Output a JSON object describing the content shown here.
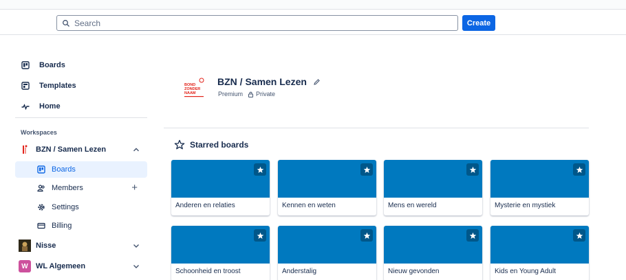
{
  "search": {
    "placeholder": "Search"
  },
  "header": {
    "create_label": "Create"
  },
  "sidebar": {
    "nav": [
      {
        "label": "Boards",
        "icon": "board-icon"
      },
      {
        "label": "Templates",
        "icon": "template-icon"
      },
      {
        "label": "Home",
        "icon": "home-pulse-icon"
      }
    ],
    "workspaces_heading": "Workspaces",
    "workspaces": [
      {
        "label": "BZN / Samen Lezen",
        "expanded": true,
        "items": [
          {
            "label": "Boards",
            "icon": "board-icon",
            "active": true
          },
          {
            "label": "Members",
            "icon": "members-icon"
          },
          {
            "label": "Settings",
            "icon": "gear-icon"
          },
          {
            "label": "Billing",
            "icon": "credit-card-icon"
          }
        ]
      },
      {
        "label": "Nisse",
        "expanded": false
      },
      {
        "label": "WL Algemeen",
        "expanded": false,
        "logo_letter": "W"
      }
    ]
  },
  "workspace": {
    "title": "BZN / Samen Lezen",
    "plan": "Premium",
    "visibility": "Private",
    "logo_text": [
      "BOND",
      "ZONDER",
      "NAAM"
    ]
  },
  "starred": {
    "heading": "Starred boards",
    "boards": [
      {
        "name": "Anderen en relaties",
        "color": "#0079bf"
      },
      {
        "name": "Kennen en weten",
        "color": "#0079bf"
      },
      {
        "name": "Mens en wereld",
        "color": "#0079bf"
      },
      {
        "name": "Mysterie en mystiek",
        "color": "#0079bf"
      },
      {
        "name": "Schoonheid en troost",
        "color": "#0079bf"
      },
      {
        "name": "Anderstalig",
        "color": "#0079bf"
      },
      {
        "name": "Nieuw gevonden",
        "color": "#0079bf"
      },
      {
        "name": "Kids en Young Adult",
        "color": "#0079bf"
      }
    ]
  },
  "colors": {
    "accent": "#0c66e4",
    "board_blue": "#0079bf",
    "logo_red": "#e2231a",
    "wl_pink": "#cd519d"
  }
}
